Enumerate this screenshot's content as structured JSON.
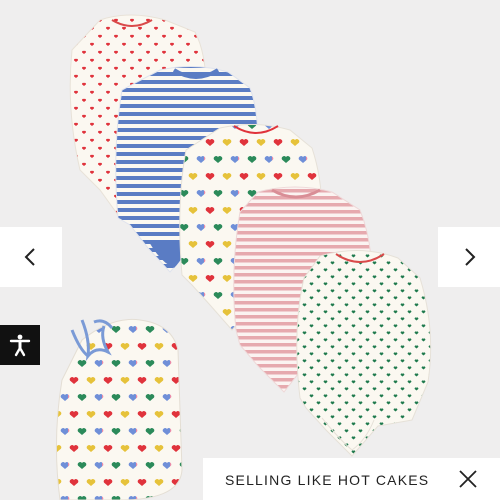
{
  "product": {
    "image_name": "baby-bodysuits-5-pack-with-bag",
    "colors": {
      "background": "#efeeee",
      "cream": "#fbf8f1",
      "heart_red": "#e0333c",
      "stripe_blue": "#5a7cc4",
      "stripe_pink": "#e6a9ae",
      "heart_green": "#1f7a4d",
      "bag_string": "#7a9ad6"
    }
  },
  "carousel": {
    "prev_icon": "chevron-left-icon",
    "next_icon": "chevron-right-icon"
  },
  "accessibility": {
    "icon": "accessibility-person-icon"
  },
  "banner": {
    "text": "SELLING LIKE HOT CAKES",
    "close_icon": "close-icon"
  }
}
